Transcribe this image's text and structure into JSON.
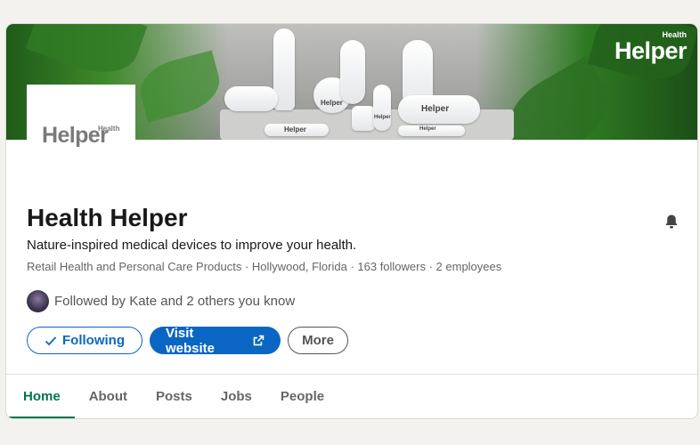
{
  "company": {
    "name": "Health Helper",
    "tagline": "Nature-inspired medical devices to improve your health.",
    "meta": "Retail Health and Personal Care Products · Hollywood, Florida · 163 followers · 2 employees"
  },
  "logo": {
    "brand_small": "Health",
    "brand_big": "Helper"
  },
  "cover": {
    "brand_small": "Health",
    "brand_big": "Helper",
    "device_labels": [
      "Helper",
      "Helper",
      "Helper",
      "Helper",
      "Helper",
      "Helper"
    ]
  },
  "followed_by": "Followed by Kate and 2 others you know",
  "actions": {
    "following_label": "Following",
    "visit_label": "Visit website",
    "more_label": "More"
  },
  "tabs": [
    {
      "label": "Home",
      "active": true
    },
    {
      "label": "About",
      "active": false
    },
    {
      "label": "Posts",
      "active": false
    },
    {
      "label": "Jobs",
      "active": false
    },
    {
      "label": "People",
      "active": false
    }
  ],
  "colors": {
    "accent": "#0a66c2",
    "active_tab": "#01754f"
  },
  "icons": [
    "bell-icon",
    "check-icon",
    "external-link-icon"
  ]
}
